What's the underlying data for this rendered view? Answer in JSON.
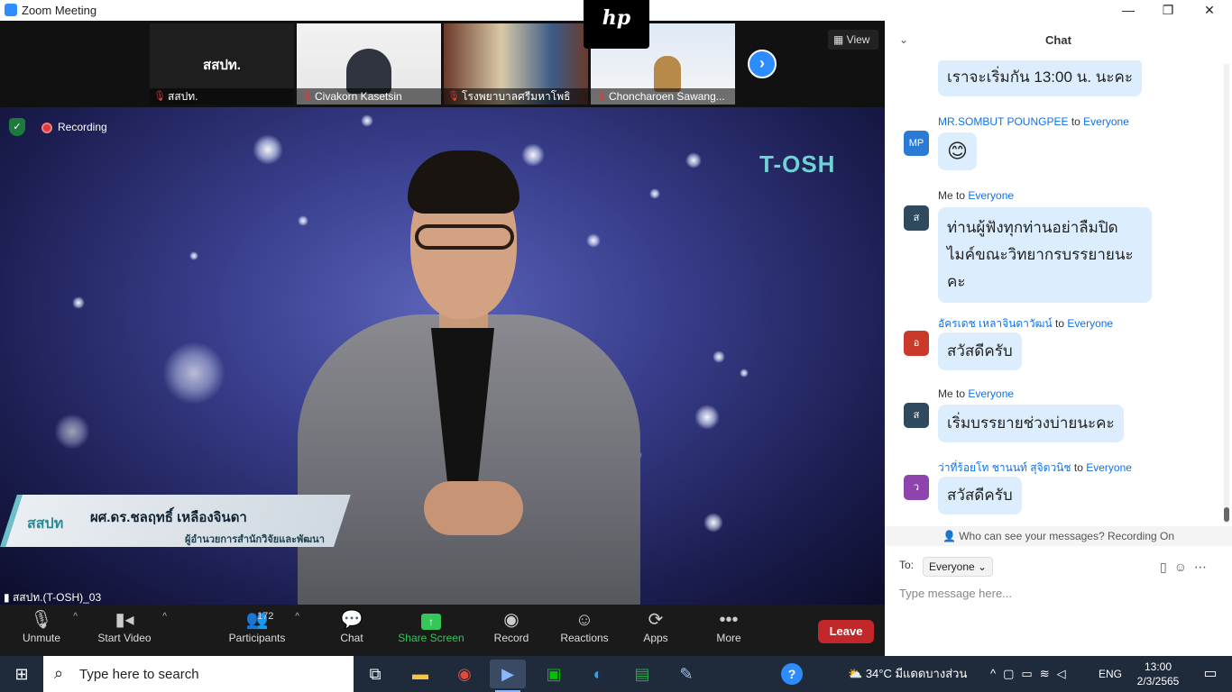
{
  "window": {
    "title": "Zoom Meeting",
    "minimize": "—",
    "maximize": "❐",
    "close": "✕"
  },
  "participants_strip": {
    "view_label": "View",
    "next_icon": "chevron-right-icon",
    "brand_logo_text": "hp",
    "tiles": [
      {
        "name": "สสปท.",
        "display": "สสปท."
      },
      {
        "name": "Civakorn Kasetsin"
      },
      {
        "name": "โรงพยาบาลศรีมหาโพธิ"
      },
      {
        "name": "Choncharoen Sawang..."
      }
    ]
  },
  "main_video": {
    "recording_label": "Recording",
    "speaker_name": "สสปท.(T-OSH)_03",
    "watermark": "T-OSH",
    "lower_third": {
      "org": "สสปท",
      "name": "ผศ.ดร.ชลฤทธิ์ เหลืองจินดา",
      "role": "ผู้อำนวยการสำนักวิจัยและพัฒนา"
    }
  },
  "toolbar": {
    "unmute": "Unmute",
    "start_video": "Start Video",
    "participants": "Participants",
    "participants_count": "172",
    "chat": "Chat",
    "share_screen": "Share Screen",
    "record": "Record",
    "reactions": "Reactions",
    "apps": "Apps",
    "more": "More",
    "leave": "Leave"
  },
  "chat": {
    "title": "Chat",
    "messages": [
      {
        "avatar": "",
        "avatar_color": "#2b7bd6",
        "sender": "",
        "to": "",
        "target": "",
        "text": "เราจะเริ่มกัน 13:00 น. นะคะ"
      },
      {
        "avatar": "MP",
        "avatar_color": "#2b7bd6",
        "sender": "MR.SOMBUT POUNGPEE",
        "to": "to",
        "target": "Everyone",
        "text": "😊"
      },
      {
        "avatar": "ส",
        "avatar_color": "#2f4a5e",
        "sender": "Me",
        "to": "to",
        "target": "Everyone",
        "text": "ท่านผู้ฟังทุกท่านอย่าลืมปิดไมค์ขณะวิทยากรบรรยายนะคะ"
      },
      {
        "avatar": "อ",
        "avatar_color": "#c93a2a",
        "sender": "อัครเดช เหลาจินดาวัฒน์",
        "to": "to",
        "target": "Everyone",
        "text": "สวัสดีครับ"
      },
      {
        "avatar": "ส",
        "avatar_color": "#2f4a5e",
        "sender": "Me",
        "to": "to",
        "target": "Everyone",
        "text": "เริ่มบรรยายช่วงบ่ายนะคะ"
      },
      {
        "avatar": "ว",
        "avatar_color": "#8e44ad",
        "sender": "ว่าที่ร้อยโท ชานนท์ สุจิตวนิช",
        "to": "to",
        "target": "Everyone",
        "text": "สวัสดีครับ"
      }
    ],
    "visibility_notice": "Who can see your messages? Recording On",
    "to_label": "To:",
    "to_value": "Everyone",
    "input_placeholder": "Type message here..."
  },
  "taskbar": {
    "search_placeholder": "Type here to search",
    "weather": "34°C มีแดดบางส่วน",
    "language": "ENG",
    "time": "13:00",
    "date": "2/3/2565"
  }
}
